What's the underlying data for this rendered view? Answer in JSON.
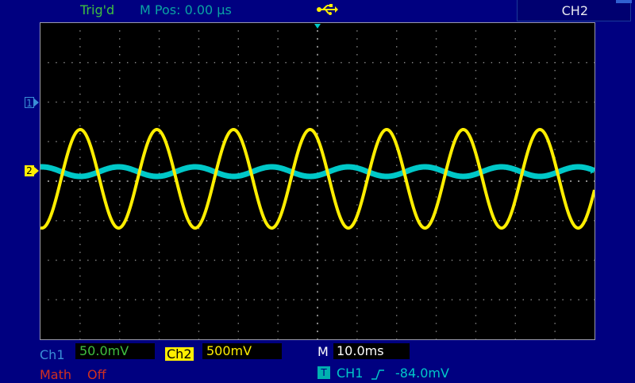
{
  "header": {
    "trigger_status": "Trig'd",
    "horizontal_position": "M Pos: 0.00 µs",
    "menu_channel": "CH2"
  },
  "markers": {
    "ch1": "1",
    "ch2": "2"
  },
  "footer": {
    "ch1_label": "Ch1",
    "ch1_scale": "50.0mV",
    "ch2_label": "Ch2",
    "ch2_scale": "500mV",
    "timebase_label": "M",
    "timebase_scale": "10.0ms",
    "math_label": "Math",
    "math_value": "Off",
    "trigger_badge": "T",
    "trigger_source": "CH1",
    "trigger_level": "-84.0mV"
  },
  "icons": {
    "usb": "usb-icon",
    "trigger_slope": "rising-edge-icon"
  },
  "colors": {
    "background": "#000080",
    "screen": "#000000",
    "ch1": "#3a8fd6",
    "ch2": "#ffee00",
    "trace_ch1": "#00c8c8",
    "trace_ch2": "#ffee00",
    "trigger": "#00c8c8",
    "math": "#d03020",
    "status_green": "#3fbf3f"
  }
}
